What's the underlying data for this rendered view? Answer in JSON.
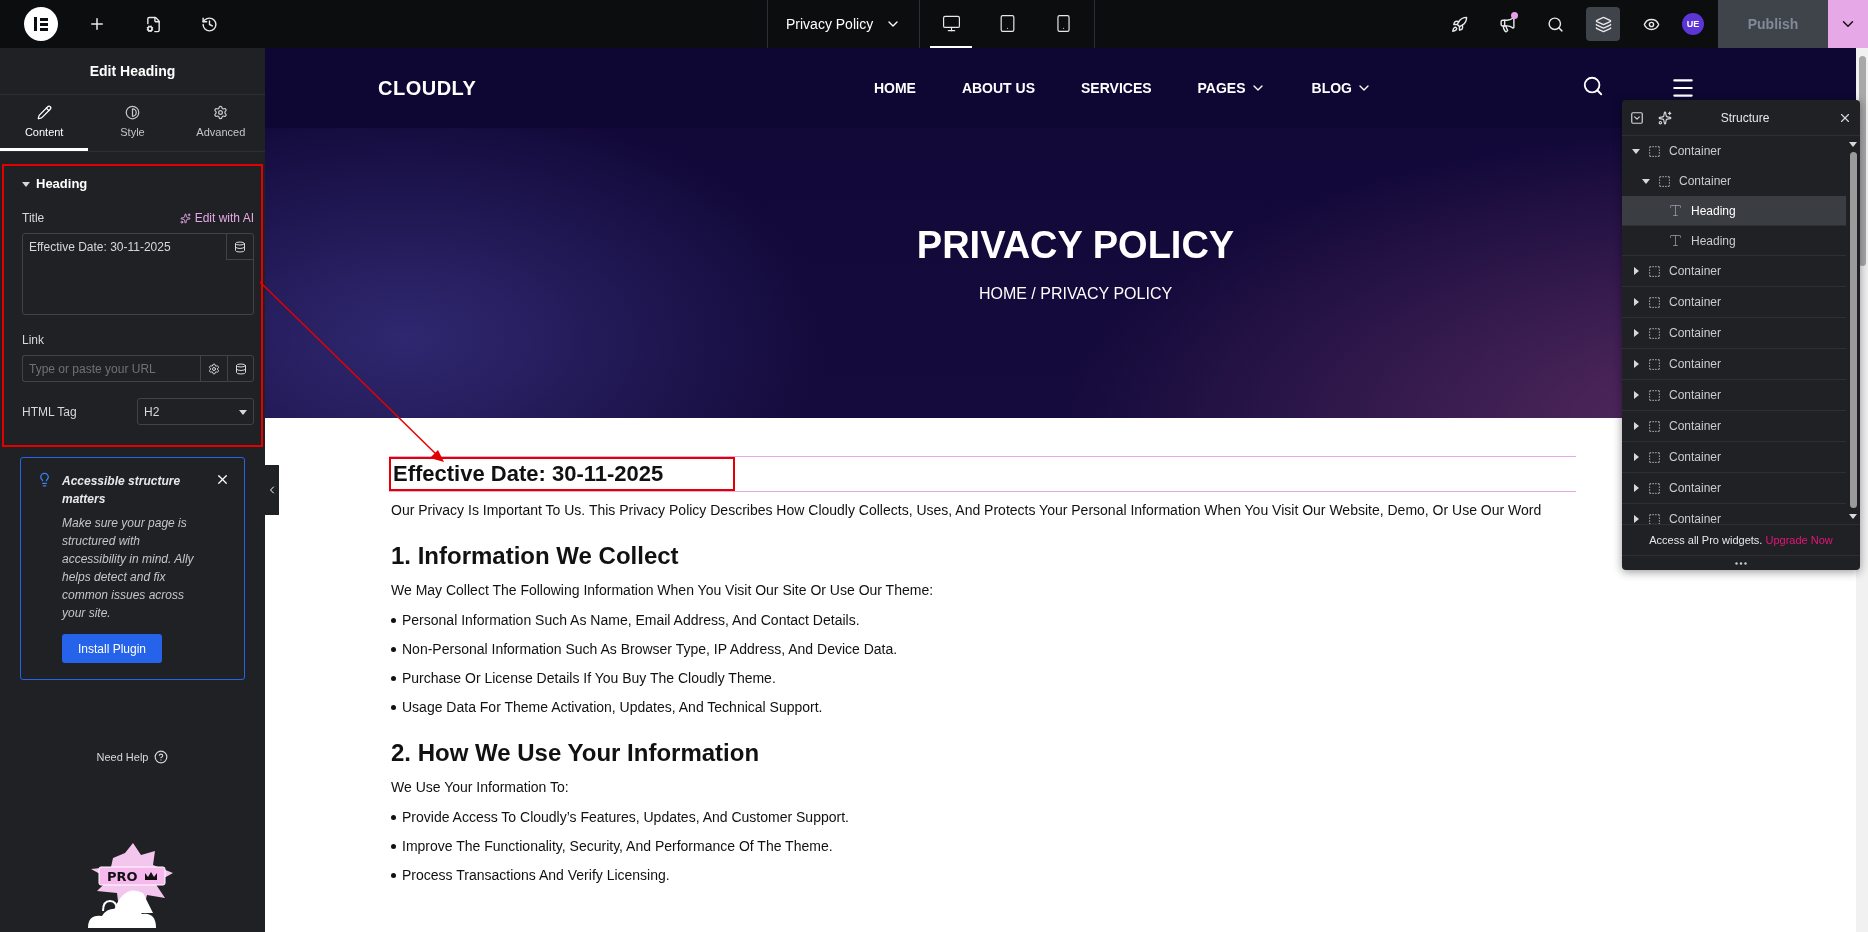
{
  "topbar": {
    "page_title": "Privacy Policy",
    "devices": [
      {
        "kind": "desktop",
        "selected": true
      },
      {
        "kind": "tablet",
        "selected": false
      },
      {
        "kind": "mobile",
        "selected": false
      }
    ],
    "tools": [
      {
        "kind": "rocket",
        "selected": false,
        "notification": false
      },
      {
        "kind": "megaphone",
        "selected": false,
        "notification": true
      },
      {
        "kind": "search",
        "selected": false,
        "notification": false
      },
      {
        "kind": "layers",
        "selected": true,
        "notification": false
      },
      {
        "kind": "eye",
        "selected": false,
        "notification": false
      }
    ],
    "avatar": "UE",
    "publish": {
      "label": "Publish",
      "disabled": true
    }
  },
  "panel": {
    "title": "Edit Heading",
    "tabs": [
      {
        "label": "Content",
        "kind": "pencil",
        "selected": true
      },
      {
        "label": "Style",
        "kind": "contrast",
        "selected": false
      },
      {
        "label": "Advanced",
        "kind": "gear",
        "selected": false
      }
    ],
    "section": {
      "title": "Heading",
      "expanded": true,
      "title_label": "Title",
      "ai_link": "Edit with AI",
      "title_value": "Effective Date: 30-11-2025",
      "link_label": "Link",
      "link_placeholder": "Type or paste your URL",
      "tag_label": "HTML Tag",
      "tag_value": "H2"
    },
    "notice": {
      "title": "Accessible structure matters",
      "body": "Make sure your page is structured with accessibility in mind. Ally helps detect and fix common issues across your site.",
      "button": "Install Plugin"
    },
    "help": "Need Help",
    "pro_badge": "PRO"
  },
  "site": {
    "logo": "CLOUDLY",
    "nav": [
      {
        "label": "HOME",
        "dropdown": false
      },
      {
        "label": "ABOUT US",
        "dropdown": false
      },
      {
        "label": "SERVICES",
        "dropdown": false
      },
      {
        "label": "PAGES",
        "dropdown": true
      },
      {
        "label": "BLOG",
        "dropdown": true
      }
    ],
    "hero_title": "PRIVACY POLICY",
    "breadcrumb": "HOME / PRIVACY POLICY",
    "content": [
      {
        "kind": "selected_heading",
        "text": "Effective Date: 30-11-2025"
      },
      {
        "kind": "paragraph",
        "text": "Our Privacy Is Important To Us. This Privacy Policy Describes How Cloudly Collects, Uses, And Protects Your Personal Information When You Visit Our Website, Demo, Or Use Our Word"
      },
      {
        "kind": "heading",
        "text": "1. Information We Collect"
      },
      {
        "kind": "paragraph",
        "text": "We May Collect The Following Information When You Visit Our Site Or Use Our Theme:"
      },
      {
        "kind": "list",
        "items": [
          "Personal Information Such As Name, Email Address, And Contact Details.",
          "Non-Personal Information Such As Browser Type, IP Address, And Device Data.",
          "Purchase Or License Details If You Buy The Cloudly Theme.",
          "Usage Data For Theme Activation, Updates, And Technical Support."
        ]
      },
      {
        "kind": "heading",
        "text": "2. How We Use Your Information"
      },
      {
        "kind": "paragraph",
        "text": "We Use Your Information To:"
      },
      {
        "kind": "list",
        "items": [
          "Provide Access To Cloudly’s Features, Updates, And Customer Support.",
          "Improve The Functionality, Security, And Performance Of The Theme.",
          "Process Transactions And Verify Licensing."
        ]
      }
    ]
  },
  "structure": {
    "title": "Structure",
    "tree": [
      {
        "label": "Container",
        "kind": "container",
        "expanded": true,
        "selected": false,
        "children": [
          {
            "label": "Container",
            "kind": "container",
            "expanded": true,
            "selected": false,
            "children": [
              {
                "label": "Heading",
                "kind": "heading",
                "selected": true
              },
              {
                "label": "Heading",
                "kind": "heading",
                "selected": false
              }
            ]
          }
        ]
      },
      {
        "label": "Container",
        "kind": "container",
        "expanded": false,
        "selected": false
      },
      {
        "label": "Container",
        "kind": "container",
        "expanded": false,
        "selected": false
      },
      {
        "label": "Container",
        "kind": "container",
        "expanded": false,
        "selected": false
      },
      {
        "label": "Container",
        "kind": "container",
        "expanded": false,
        "selected": false
      },
      {
        "label": "Container",
        "kind": "container",
        "expanded": false,
        "selected": false
      },
      {
        "label": "Container",
        "kind": "container",
        "expanded": false,
        "selected": false
      },
      {
        "label": "Container",
        "kind": "container",
        "expanded": false,
        "selected": false
      },
      {
        "label": "Container",
        "kind": "container",
        "expanded": false,
        "selected": false
      },
      {
        "label": "Container",
        "kind": "container",
        "expanded": false,
        "selected": false
      }
    ],
    "promo": "Access all Pro widgets.",
    "promo_link": "Upgrade Now"
  }
}
